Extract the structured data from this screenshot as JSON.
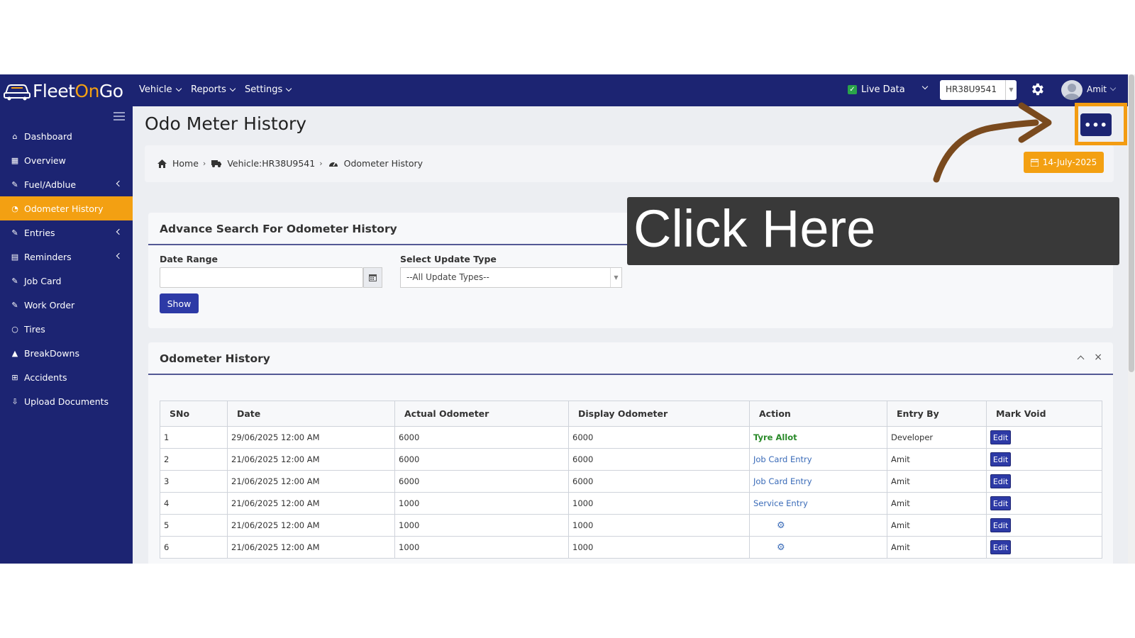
{
  "app": {
    "logo_pre": "Fleet",
    "logo_mid": "On",
    "logo_post": "Go"
  },
  "topnav": [
    {
      "label": "Vehicle"
    },
    {
      "label": "Reports"
    },
    {
      "label": "Settings"
    }
  ],
  "header": {
    "live_label": "Live Data",
    "vehicle_value": "HR38U9541",
    "username": "Amit"
  },
  "sidebar": {
    "items": [
      {
        "label": "Dashboard",
        "icon": "home-icon"
      },
      {
        "label": "Overview",
        "icon": "grid-icon"
      },
      {
        "label": "Fuel/Adblue",
        "icon": "edit-icon"
      },
      {
        "label": "Odometer History",
        "icon": "tachometer-icon"
      },
      {
        "label": "Entries",
        "icon": "edit-icon"
      },
      {
        "label": "Reminders",
        "icon": "calendar-icon"
      },
      {
        "label": "Job Card",
        "icon": "edit-icon"
      },
      {
        "label": "Work Order",
        "icon": "edit-icon"
      },
      {
        "label": "Tires",
        "icon": "circle-icon"
      },
      {
        "label": "BreakDowns",
        "icon": "warning-icon"
      },
      {
        "label": "Accidents",
        "icon": "plus-square-icon"
      },
      {
        "label": "Upload Documents",
        "icon": "upload-icon"
      }
    ]
  },
  "page": {
    "title": "Odo Meter History",
    "breadcrumb": {
      "home": "Home",
      "vehicle": "Vehicle:HR38U9541",
      "current": "Odometer History"
    },
    "date": "14-July-2025",
    "menu_label": "•••"
  },
  "search": {
    "title": "Advance Search For Odometer History",
    "date_range_label": "Date Range",
    "date_range_value": "",
    "update_type_label": "Select Update Type",
    "update_type_value": "--All Update Types--",
    "show_label": "Show"
  },
  "history": {
    "title": "Odometer History",
    "close": "×",
    "columns": [
      "SNo",
      "Date",
      "Actual Odometer",
      "Display Odometer",
      "Action",
      "Entry By",
      "Mark Void"
    ],
    "rows": [
      {
        "sno": "1",
        "date": "29/06/2025 12:00 AM",
        "actual": "6000",
        "display": "6000",
        "action": "Tyre Allot",
        "action_type": "tyre",
        "entry_by": "Developer",
        "void": "Edit"
      },
      {
        "sno": "2",
        "date": "21/06/2025 12:00 AM",
        "actual": "6000",
        "display": "6000",
        "action": "Job Card Entry",
        "action_type": "link",
        "entry_by": "Amit",
        "void": "Edit"
      },
      {
        "sno": "3",
        "date": "21/06/2025 12:00 AM",
        "actual": "6000",
        "display": "6000",
        "action": "Job Card Entry",
        "action_type": "link",
        "entry_by": "Amit",
        "void": "Edit"
      },
      {
        "sno": "4",
        "date": "21/06/2025 12:00 AM",
        "actual": "1000",
        "display": "1000",
        "action": "Service Entry",
        "action_type": "link",
        "entry_by": "Amit",
        "void": "Edit"
      },
      {
        "sno": "5",
        "date": "21/06/2025 12:00 AM",
        "actual": "1000",
        "display": "1000",
        "action": "",
        "action_type": "gear",
        "entry_by": "Amit",
        "void": "Edit"
      },
      {
        "sno": "6",
        "date": "21/06/2025 12:00 AM",
        "actual": "1000",
        "display": "1000",
        "action": "",
        "action_type": "gear",
        "entry_by": "Amit",
        "void": "Edit"
      }
    ]
  },
  "overlay": {
    "tooltip_text": "Click Here"
  },
  "colors": {
    "navy": "#1c2472",
    "accent": "#f3a012",
    "highlight": "#f39c12",
    "arrow": "#7a4a1e"
  }
}
